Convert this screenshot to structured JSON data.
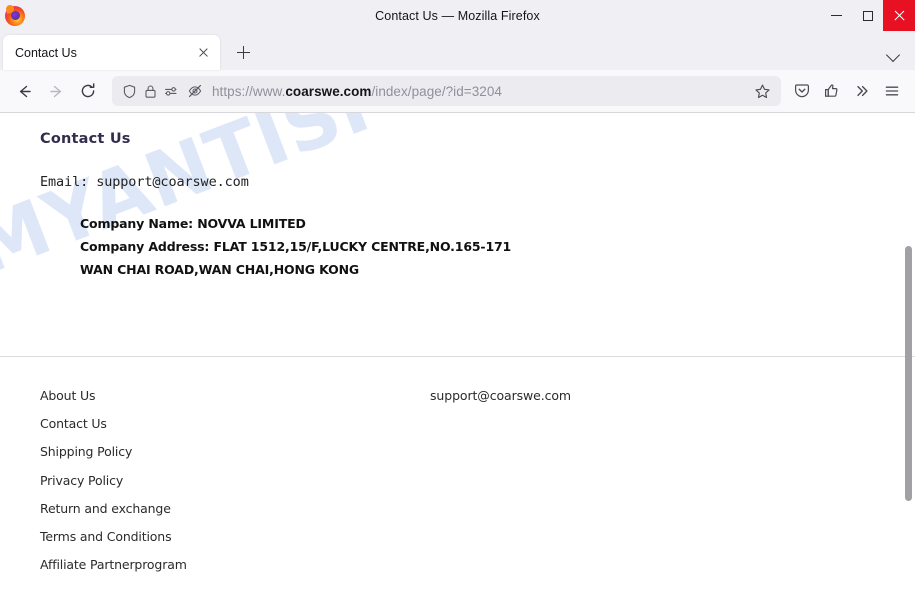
{
  "window": {
    "title": "Contact Us — Mozilla Firefox",
    "minimize_label": "Minimize",
    "maximize_label": "Maximize",
    "close_label": "Close"
  },
  "tabbar": {
    "tabs": [
      {
        "title": "Contact Us",
        "close_label": "Close tab"
      }
    ],
    "new_tab_label": "New tab",
    "list_all_tabs_label": "List all tabs"
  },
  "toolbar": {
    "back_label": "Go back one page",
    "forward_label": "Go forward one page",
    "reload_label": "Reload current page",
    "url_prefix": "https://www.",
    "url_host": "coarswe.com",
    "url_path": "/index/page/?id=3204",
    "url_full": "https://www.coarswe.com/index/page/?id=3204",
    "bookmark_label": "Bookmark this page",
    "pocket_label": "Save to Pocket",
    "share_label": "Share this page",
    "overflow_label": "More tools",
    "menu_label": "Open application menu",
    "shield_label": "Enhanced tracking protection",
    "lock_label": "Connection is secure",
    "permissions_label": "Site permissions",
    "autoplay_blocked_label": "Autoplay blocked"
  },
  "page": {
    "watermark": "MYANTISPYWARE.COM",
    "title": "Contact Us",
    "email_line": "Email: support@coarswe.com",
    "company_lines": [
      "Company Name: NOVVA LIMITED",
      "Company Address: FLAT 1512,15/F,LUCKY CENTRE,NO.165-171",
      "WAN CHAI ROAD,WAN CHAI,HONG KONG"
    ],
    "footer": {
      "links": [
        "About Us",
        "Contact Us",
        "Shipping Policy",
        "Privacy Policy",
        "Return and exchange",
        "Terms and Conditions",
        "Affiliate Partnerprogram"
      ],
      "contact_email": "support@coarswe.com"
    }
  },
  "colors": {
    "title_heading": "#332d4d",
    "watermark": "#c9d9f4",
    "close_button": "#e81123",
    "chrome_bg": "#f0f0f4",
    "urlbar_bg": "#ececf0"
  }
}
